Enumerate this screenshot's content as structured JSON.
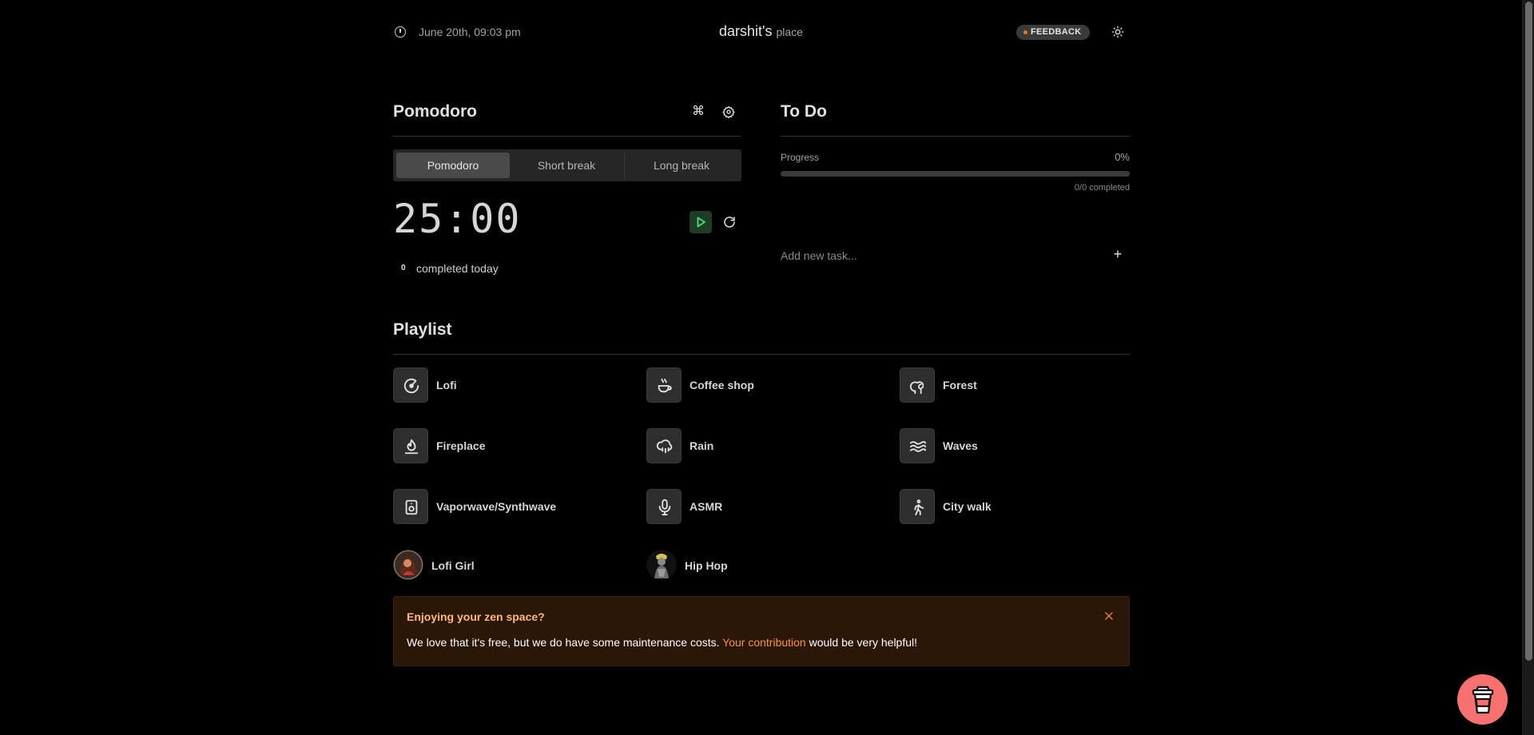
{
  "header": {
    "datetime": "June 20th, 09:03 pm",
    "brand_name": "darshit's",
    "brand_suffix": "place",
    "feedback_label": "FEEDBACK"
  },
  "pomodoro": {
    "title": "Pomodoro",
    "tabs": [
      "Pomodoro",
      "Short break",
      "Long break"
    ],
    "active_tab": "Pomodoro",
    "timer": "25:00",
    "completed_count": "0",
    "completed_label": "completed today"
  },
  "todo": {
    "title": "To Do",
    "progress_label": "Progress",
    "progress_percent": "0%",
    "progress_fraction": 0,
    "completed_text": "0/0 completed",
    "input_placeholder": "Add new task...",
    "add_symbol": "+"
  },
  "playlist": {
    "title": "Playlist",
    "items": [
      {
        "label": "Lofi",
        "icon": "vinyl-icon"
      },
      {
        "label": "Coffee shop",
        "icon": "coffee-icon"
      },
      {
        "label": "Forest",
        "icon": "trees-icon"
      },
      {
        "label": "Fireplace",
        "icon": "flame-icon"
      },
      {
        "label": "Rain",
        "icon": "cloud-rain-icon"
      },
      {
        "label": "Waves",
        "icon": "waves-icon"
      },
      {
        "label": "Vaporwave/Synthwave",
        "icon": "speaker-icon"
      },
      {
        "label": "ASMR",
        "icon": "microphone-icon"
      },
      {
        "label": "City walk",
        "icon": "walking-icon"
      }
    ],
    "channels": [
      {
        "label": "Lofi Girl",
        "avatar": "lofi-girl-avatar"
      },
      {
        "label": "Hip Hop",
        "avatar": "hip-hop-avatar"
      }
    ]
  },
  "banner": {
    "title": "Enjoying your zen space?",
    "text_before": "We love that it's free, but we do have some maintenance costs. ",
    "link_text": "Your contribution",
    "text_after": " would be very helpful!"
  },
  "colors": {
    "accent_orange": "#fb923c",
    "play_green": "#4ade80",
    "coffee_button": "#f87171"
  }
}
